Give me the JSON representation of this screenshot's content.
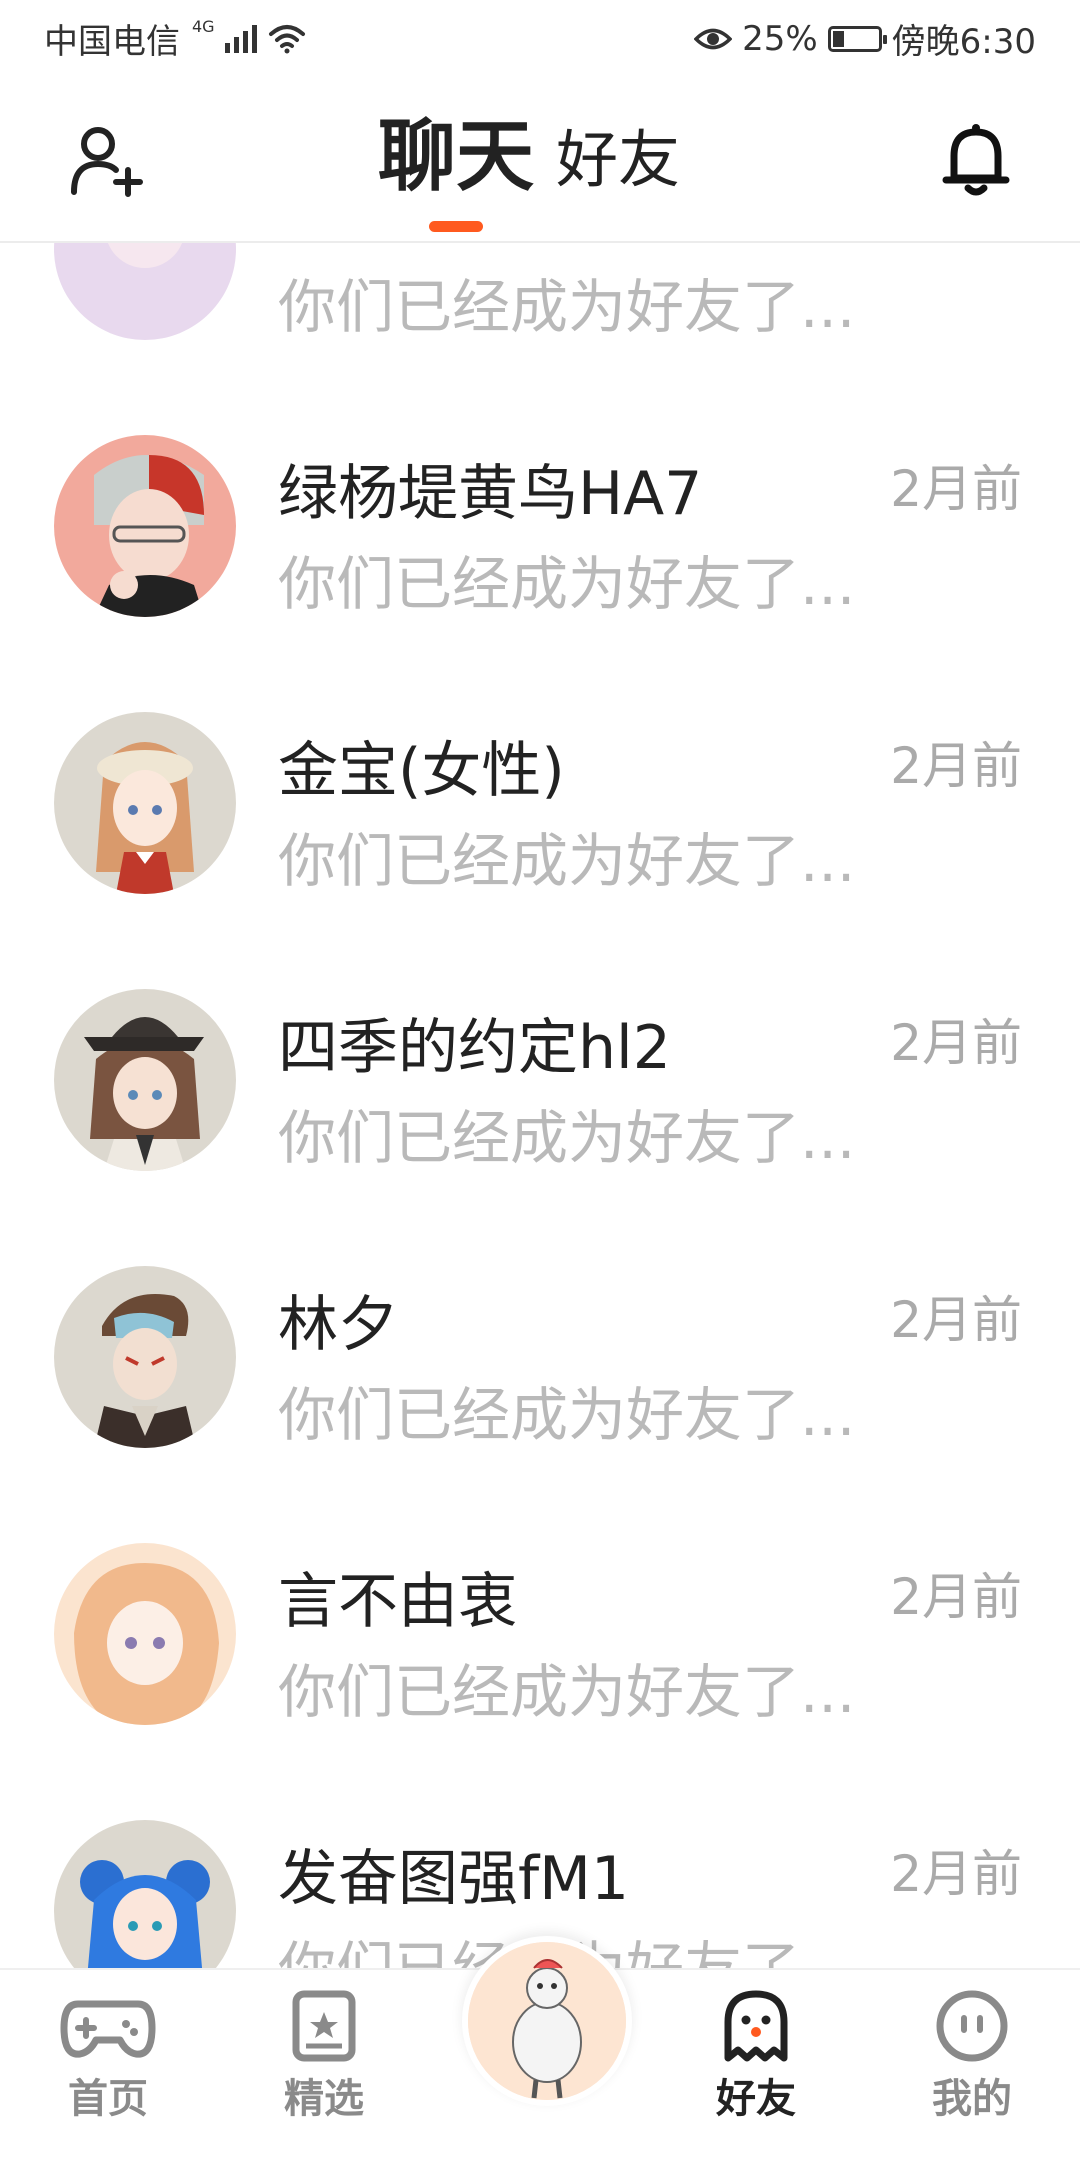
{
  "status_bar": {
    "carrier": "中国电信",
    "network_tag": "4G",
    "battery_percent": "25%",
    "battery_level": 0.25,
    "time": "傍晚6:30",
    "icons": [
      "signal-icon",
      "wifi-icon",
      "eye-icon",
      "battery-icon"
    ]
  },
  "header": {
    "active_tab": "聊天",
    "other_tab": "好友",
    "left_icon": "add-friend-icon",
    "right_icon": "bell-icon",
    "accent_color": "#ff5a1f"
  },
  "chats": {
    "partial_top": {
      "message": "你们已经成为好友了..."
    },
    "items": [
      {
        "name": "绿杨堤黄鸟HA7",
        "time": "2月前",
        "message": "你们已经成为好友了..."
      },
      {
        "name": "金宝(女性)",
        "time": "2月前",
        "message": "你们已经成为好友了..."
      },
      {
        "name": "四季的约定hl2",
        "time": "2月前",
        "message": "你们已经成为好友了..."
      },
      {
        "name": "林夕",
        "time": "2月前",
        "message": "你们已经成为好友了..."
      },
      {
        "name": "言不由衷",
        "time": "2月前",
        "message": "你们已经成为好友了..."
      },
      {
        "name": "发奋图强fM1",
        "time": "2月前",
        "message": "你们已经成为好友了..."
      }
    ]
  },
  "bottom_nav": {
    "items": [
      {
        "label": "首页",
        "icon": "gamepad-icon"
      },
      {
        "label": "精选",
        "icon": "star-card-icon"
      },
      {
        "label": "",
        "icon": "character-avatar-icon"
      },
      {
        "label": "好友",
        "icon": "ghost-icon"
      },
      {
        "label": "我的",
        "icon": "face-icon"
      }
    ],
    "active": "好友"
  }
}
